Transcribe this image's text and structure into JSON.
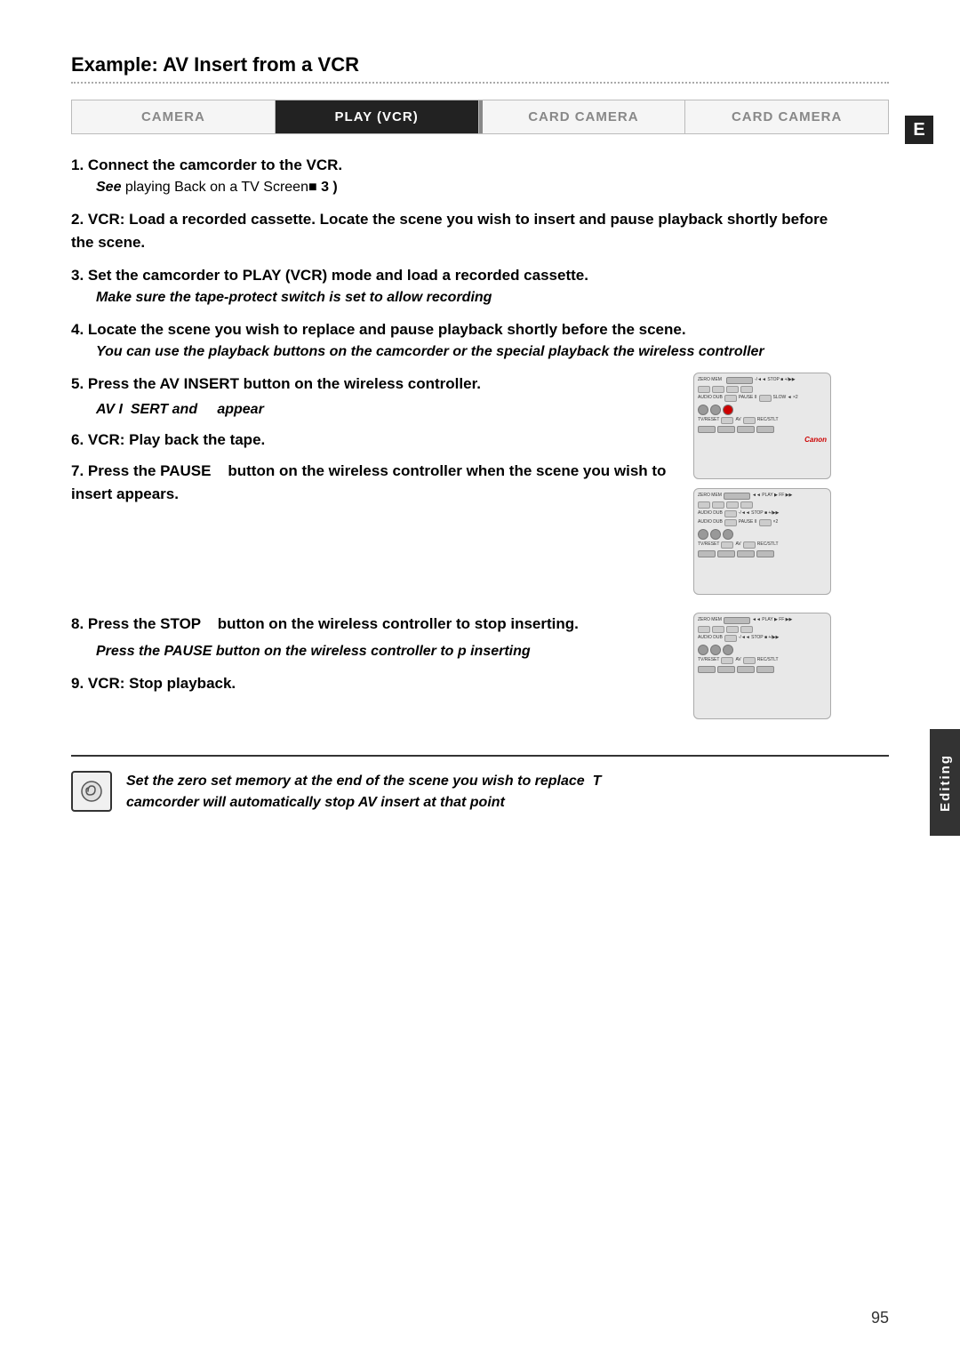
{
  "page": {
    "title": "Example: AV Insert from a VCR",
    "page_number": "95",
    "e_badge": "E"
  },
  "tabs": [
    {
      "id": "camera",
      "label": "CAMERA",
      "active": false
    },
    {
      "id": "play-vcr",
      "label": "PLAY (VCR)",
      "active": true
    },
    {
      "id": "card-camera-1",
      "label": "CARD CAMERA",
      "active": false
    },
    {
      "id": "card-camera-2",
      "label": "CARD CAMERA",
      "active": false
    }
  ],
  "steps": [
    {
      "number": "1",
      "text": "Connect the camcorder to the VCR.",
      "sub": null,
      "see": "See Playing Back on a TV Screen  3  )"
    },
    {
      "number": "2",
      "text": "VCR: Load a recorded cassette. Locate the scene you wish to insert and pause playback shortly before the scene."
    },
    {
      "number": "3",
      "text": "Set the camcorder to PLAY (VCR) mode and load a recorded cassette.",
      "note": "Make sure the tape-protect switch is set to allow recording"
    },
    {
      "number": "4",
      "text": "Locate the scene you wish to replace and pause playback shortly before the scene.",
      "italic_note": "You can use the playback buttons on the camcorder or the special playback the wireless controller"
    },
    {
      "number": "5",
      "text": "Press the AV INSERT button on the wireless controller.",
      "av_note": "AV I  SERT and    appear",
      "has_image": true,
      "image_id": "remote1"
    },
    {
      "number": "6",
      "text": "VCR: Play back the tape."
    },
    {
      "number": "7",
      "text": "Press the PAUSE   button on the wireless controller when the scene you wish to insert appears.",
      "has_image": true,
      "image_id": "remote2"
    },
    {
      "number": "8",
      "text": "Press the STOP   button on the wireless controller to stop inserting.",
      "italic_note2": "Press the PAUSE button on the wireless controller to pause inserting",
      "has_image": true,
      "image_id": "remote3"
    },
    {
      "number": "9",
      "text": "VCR: Stop playback."
    }
  ],
  "note_box": {
    "icon": "📎",
    "text": "Set the zero set memory at the end of the scene you wish to replace  T camcorder will automatically stop AV insert at that point"
  },
  "editing_label": "Editing"
}
